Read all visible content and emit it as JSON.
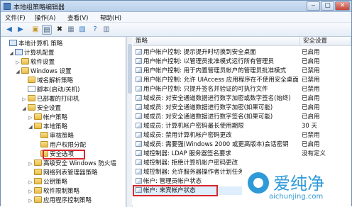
{
  "window": {
    "title": "本地组策略编辑器"
  },
  "menu": [
    "文件(F)",
    "操作(A)",
    "查看(V)",
    "帮助(H)"
  ],
  "tree": [
    {
      "label": "本地计算机 策略",
      "toggle": "",
      "icon": "comp"
    },
    {
      "label": "计算机配置",
      "toggle": "◢",
      "icon": "comp"
    },
    {
      "label": "软件设置",
      "toggle": "▷",
      "icon": "fold"
    },
    {
      "label": "Windows 设置",
      "toggle": "◢",
      "icon": "fold"
    },
    {
      "label": "域名解析策略",
      "toggle": "",
      "icon": "fold"
    },
    {
      "label": "脚本(启动/关机)",
      "toggle": "",
      "icon": "doc"
    },
    {
      "label": "已部署的打印机",
      "toggle": "▷",
      "icon": "fold"
    },
    {
      "label": "安全设置",
      "toggle": "◢",
      "icon": "fold"
    },
    {
      "label": "帐户策略",
      "toggle": "▷",
      "icon": "fold"
    },
    {
      "label": "本地策略",
      "toggle": "◢",
      "icon": "fold"
    },
    {
      "label": "审核策略",
      "toggle": "",
      "icon": "fold"
    },
    {
      "label": "用户权限分配",
      "toggle": "",
      "icon": "fold"
    },
    {
      "label": "安全选项",
      "toggle": "",
      "icon": "fold"
    },
    {
      "label": "高级安全 Windows 防火墙",
      "toggle": "▷",
      "icon": "fold"
    },
    {
      "label": "网络列表管理器策略",
      "toggle": "",
      "icon": "fold"
    },
    {
      "label": "公钥策略",
      "toggle": "▷",
      "icon": "fold"
    },
    {
      "label": "软件限制策略",
      "toggle": "▷",
      "icon": "fold"
    },
    {
      "label": "应用程序控制策略",
      "toggle": "▷",
      "icon": "fold"
    }
  ],
  "list": {
    "headers": [
      "策略",
      "安全设置"
    ],
    "rows": [
      {
        "policy": "用户帐户控制: 提示提升时切换到安全桌面",
        "setting": "已启用"
      },
      {
        "policy": "用户帐户控制: 以管理员批准模式运行所有管理员",
        "setting": "已启用"
      },
      {
        "policy": "用户帐户控制: 用于内置管理员帐户的管理员批准模式",
        "setting": "已禁用"
      },
      {
        "policy": "用户帐户控制: 允许 UIAccess 应用程序在不使用安全桌面",
        "setting": "已禁用"
      },
      {
        "policy": "用户帐户控制: 只提升签名并验证的可执行文件",
        "setting": "已禁用"
      },
      {
        "policy": "域成员: 对安全通道数据进行数字加密或数字签名(始终)",
        "setting": "已启用"
      },
      {
        "policy": "域成员: 对安全通道数据进行数字加密(如果可能)",
        "setting": "已启用"
      },
      {
        "policy": "域成员: 对安全通道数据进行数字签名(如果可能)",
        "setting": "已启用"
      },
      {
        "policy": "域成员: 计算机帐户密码最长使用期限",
        "setting": "30 天"
      },
      {
        "policy": "域成员: 禁用计算机帐户密码更改",
        "setting": "已禁用"
      },
      {
        "policy": "域成员: 需要强(Windows 2000 或更高版本)会话密钥",
        "setting": "已启用"
      },
      {
        "policy": "域控制器: LDAP 服务器签名要求",
        "setting": "没有定义"
      },
      {
        "policy": "域控制器: 拒绝计算机帐户密码更改",
        "setting": ""
      },
      {
        "policy": "域控制器: 允许服务器操作者计划任务",
        "setting": ""
      },
      {
        "policy": "帐户: 管理员帐户状态",
        "setting": ""
      },
      {
        "policy": "帐户: 来宾帐户状态",
        "setting": ""
      }
    ]
  },
  "watermark": {
    "text": "爱纯净",
    "url": "aichunjing.com"
  },
  "colors": {
    "highlight": "#d9262b",
    "brand": "#2f9ad8"
  }
}
